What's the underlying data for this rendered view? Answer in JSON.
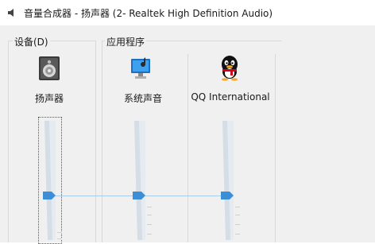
{
  "window": {
    "title": "音量合成器 - 扬声器 (2- Realtek High Definition Audio)"
  },
  "groups": {
    "device_label": "设备(D)",
    "apps_label": "应用程序"
  },
  "device": {
    "label": "扬声器",
    "icon": "speaker-icon",
    "volume_percent": 35
  },
  "apps": [
    {
      "label": "系统声音",
      "icon": "system-sounds-icon",
      "volume_percent": 35
    },
    {
      "label": "QQ International",
      "icon": "qq-penguin-icon",
      "volume_percent": 35
    }
  ],
  "colors": {
    "accent": "#3c8fd6",
    "track_light": "#e9eef3",
    "link": "#a9cce8"
  }
}
